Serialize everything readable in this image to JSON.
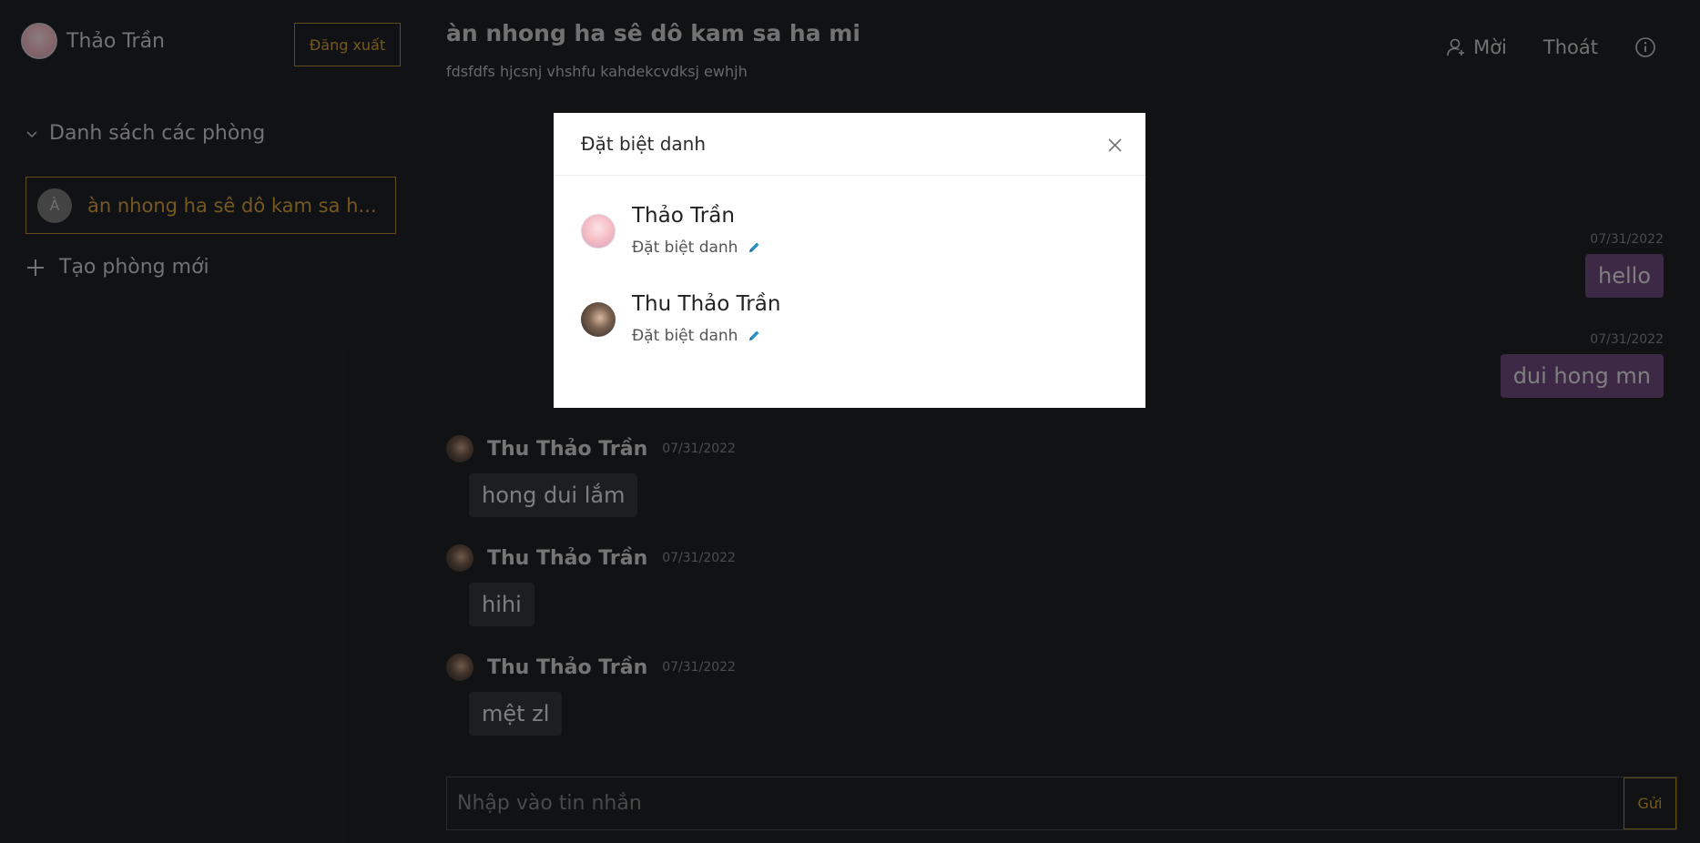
{
  "sidebar": {
    "user_name": "Thảo Trần",
    "logout_label": "Đăng xuất",
    "rooms_label": "Danh sách các phòng",
    "rooms": [
      {
        "avatar_letter": "À",
        "name": "àn nhong ha sê dô kam sa h..."
      }
    ],
    "new_room_label": "Tạo phòng mới"
  },
  "header": {
    "title": "àn nhong ha sê dô kam sa ha mi",
    "description": "fdsfdfs hjcsnj vhshfu kahdekcvdksj ewhjh",
    "invite_label": "Mời",
    "leave_label": "Thoát",
    "info_icon": "info-icon"
  },
  "messages": {
    "mine": [
      {
        "date": "07/31/2022",
        "text": "hello"
      },
      {
        "date": "07/31/2022",
        "text": "dui hong mn"
      }
    ],
    "others": [
      {
        "user": "Thu Thảo Trần",
        "time": "07/31/2022",
        "text": "hong dui lắm"
      },
      {
        "user": "Thu Thảo Trần",
        "time": "07/31/2022",
        "text": "hihi"
      },
      {
        "user": "Thu Thảo Trần",
        "time": "07/31/2022",
        "text": "mệt zl"
      }
    ]
  },
  "composer": {
    "placeholder": "Nhập vào tin nhắn",
    "send_label": "Gửi"
  },
  "modal": {
    "title": "Đặt biệt danh",
    "members": [
      {
        "name": "Thảo Trần",
        "nickname_action": "Đặt biệt danh"
      },
      {
        "name": "Thu Thảo Trần",
        "nickname_action": "Đặt biệt danh"
      }
    ]
  },
  "colors": {
    "accent": "#d6a23a",
    "own_bubble": "#704a80",
    "other_bubble": "#34373b",
    "background": "#1e2124"
  }
}
